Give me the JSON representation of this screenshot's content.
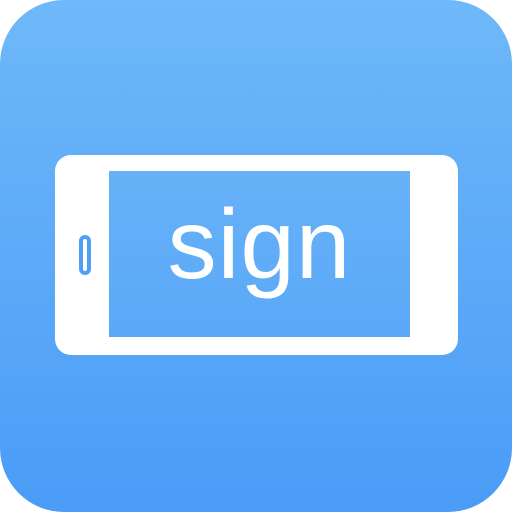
{
  "icon": {
    "label": "sign",
    "colors": {
      "background_top": "#6fb8f9",
      "background_bottom": "#4a9cf7",
      "device_frame": "#ffffff",
      "text": "#ffffff"
    },
    "glyph": "phone-landscape-icon"
  }
}
